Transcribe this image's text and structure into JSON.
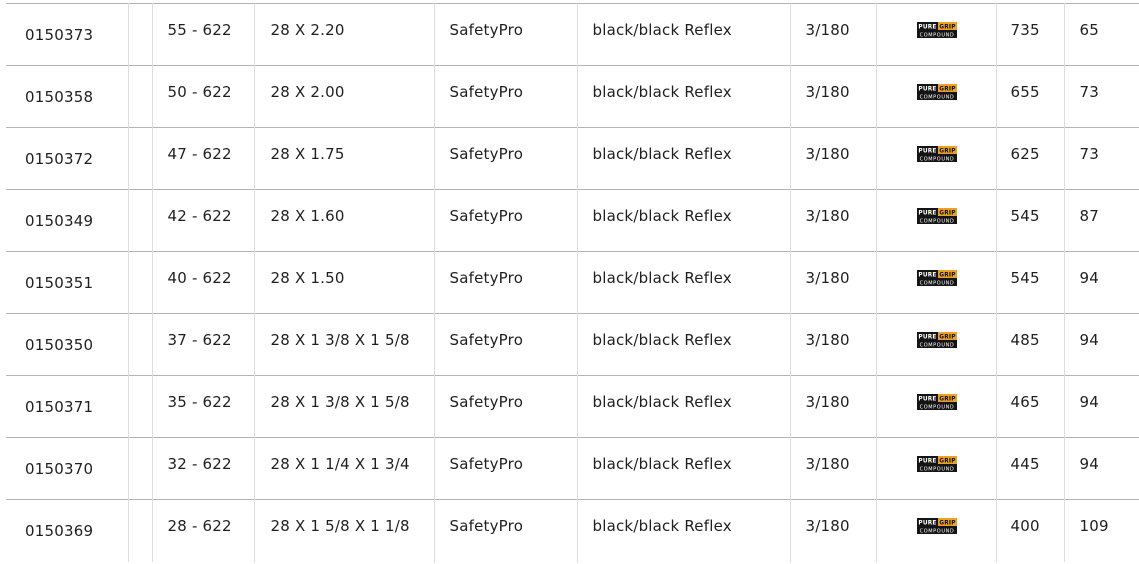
{
  "badge": {
    "word_left": "PURE",
    "word_right": "GRIP",
    "word_bottom": "COMPOUND",
    "accent_color": "#f0a020",
    "dark_color": "#141414",
    "icon": "pure-grip-compound-icon"
  },
  "rows": [
    {
      "article": "0150373",
      "etrto": "55 - 622",
      "size": "28 X 2.20",
      "line": "SafetyPro",
      "color": "black/black Reflex",
      "pressure": "3/180",
      "weight": "735",
      "price": "65"
    },
    {
      "article": "0150358",
      "etrto": "50 - 622",
      "size": "28 X 2.00",
      "line": "SafetyPro",
      "color": "black/black Reflex",
      "pressure": "3/180",
      "weight": "655",
      "price": "73"
    },
    {
      "article": "0150372",
      "etrto": "47 - 622",
      "size": "28 X 1.75",
      "line": "SafetyPro",
      "color": "black/black Reflex",
      "pressure": "3/180",
      "weight": "625",
      "price": "73"
    },
    {
      "article": "0150349",
      "etrto": "42 - 622",
      "size": "28 X 1.60",
      "line": "SafetyPro",
      "color": "black/black Reflex",
      "pressure": "3/180",
      "weight": "545",
      "price": "87"
    },
    {
      "article": "0150351",
      "etrto": "40 - 622",
      "size": "28 X 1.50",
      "line": "SafetyPro",
      "color": "black/black Reflex",
      "pressure": "3/180",
      "weight": "545",
      "price": "94"
    },
    {
      "article": "0150350",
      "etrto": "37 - 622",
      "size": "28 X 1 3/8 X 1 5/8",
      "line": "SafetyPro",
      "color": "black/black Reflex",
      "pressure": "3/180",
      "weight": "485",
      "price": "94"
    },
    {
      "article": "0150371",
      "etrto": "35 - 622",
      "size": "28 X 1 3/8 X 1 5/8",
      "line": "SafetyPro",
      "color": "black/black Reflex",
      "pressure": "3/180",
      "weight": "465",
      "price": "94"
    },
    {
      "article": "0150370",
      "etrto": "32 - 622",
      "size": "28 X 1 1/4 X 1 3/4",
      "line": "SafetyPro",
      "color": "black/black Reflex",
      "pressure": "3/180",
      "weight": "445",
      "price": "94"
    },
    {
      "article": "0150369",
      "etrto": "28 - 622",
      "size": "28 X 1 5/8 X 1 1/8",
      "line": "SafetyPro",
      "color": "black/black Reflex",
      "pressure": "3/180",
      "weight": "400",
      "price": "109"
    }
  ]
}
